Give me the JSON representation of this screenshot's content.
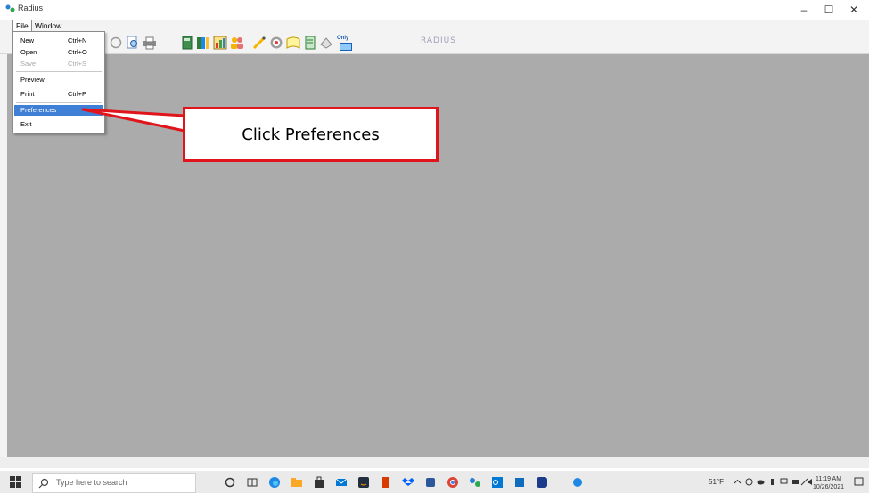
{
  "window": {
    "title": "Radius",
    "controls": {
      "minimize": "–",
      "maximize": "☐",
      "close": "✕"
    }
  },
  "menubar": {
    "items": [
      "File",
      "Window"
    ]
  },
  "file_menu": {
    "items": [
      {
        "label": "New",
        "shortcut": "Ctrl+N",
        "disabled": false
      },
      {
        "label": "Open",
        "shortcut": "Ctrl+O",
        "disabled": false
      },
      {
        "label": "Save",
        "shortcut": "Ctrl+S",
        "disabled": true
      },
      {
        "label": "Preview",
        "shortcut": "",
        "disabled": false
      },
      {
        "label": "Print",
        "shortcut": "Ctrl+P",
        "disabled": false
      },
      {
        "label": "Preferences",
        "shortcut": "",
        "disabled": false,
        "highlighted": true
      },
      {
        "label": "Exit",
        "shortcut": "",
        "disabled": false
      }
    ]
  },
  "toolbar": {
    "icons": [
      "refresh-icon",
      "print-preview-icon",
      "printer-icon",
      "notebook-icon",
      "books-icon",
      "chart-icon",
      "people-icon",
      "pencil-icon",
      "target-icon",
      "bookshelf-icon",
      "document-icon",
      "stamp-icon",
      "calendar-only-icon"
    ],
    "calendar_label": "Only",
    "brand_logo_text": "RADIUS"
  },
  "callout": {
    "text": "Click Preferences",
    "border_color": "#e0151b"
  },
  "taskbar": {
    "search_placeholder": "Type here to search",
    "weather": "51°F",
    "clock_time": "11:19 AM",
    "clock_date": "10/26/2021"
  },
  "colors": {
    "workspace": "#ababab",
    "highlight": "#3f7fd6",
    "accent_red": "#e0151b"
  }
}
